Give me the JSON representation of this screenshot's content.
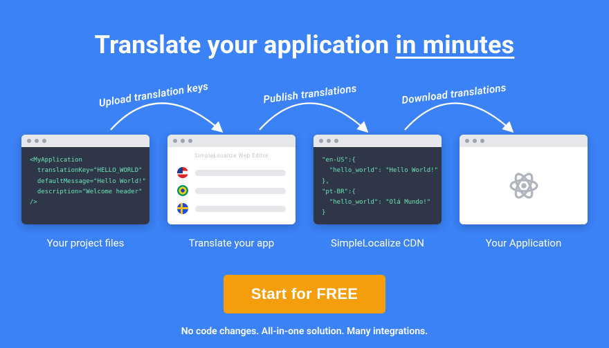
{
  "headline": {
    "prefix": "Translate your application ",
    "underlined": "in minutes"
  },
  "arrows": {
    "a1": "Upload translation keys",
    "a2": "Publish translations",
    "a3": "Download translations"
  },
  "cards": {
    "project": {
      "caption": "Your project files",
      "code": "<MyApplication\n  translationKey=\"HELLO_WORLD\"\n  defaultMessage=\"Hello World!\"\n  description=\"Welcome header\"\n/>"
    },
    "editor": {
      "caption": "Translate your app",
      "title": "SimpleLocalize Web Editor",
      "languages": [
        "us",
        "br",
        "se"
      ]
    },
    "cdn": {
      "caption": "SimpleLocalize CDN",
      "code": "\"en-US\":{\n  \"hello_world\": \"Hello World!\"\n},\n\"pt-BR\":{\n  \"hello_world\": \"Olá Mundo!\"\n}"
    },
    "app": {
      "caption": "Your Application"
    }
  },
  "cta": "Start for FREE",
  "subline": "No code changes. All-in-one solution. Many integrations."
}
